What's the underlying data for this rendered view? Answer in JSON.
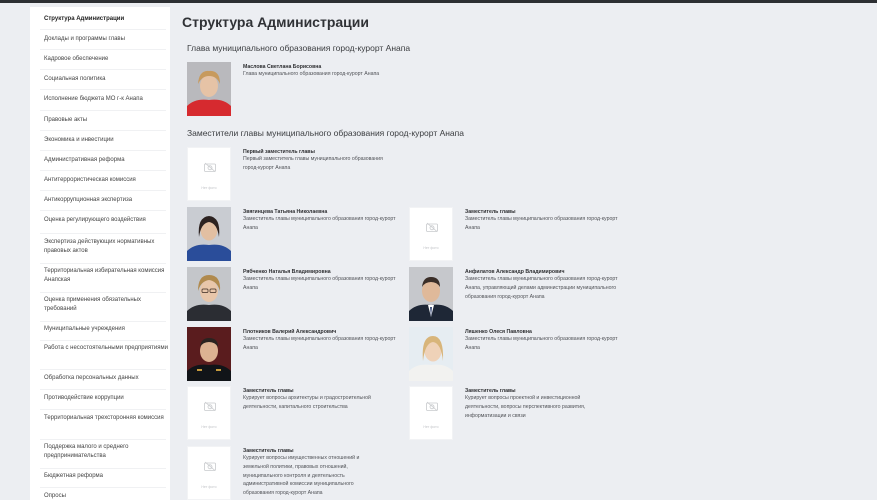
{
  "page_title": "Структура Администрации",
  "sidebar": {
    "items": [
      {
        "label": "Структура Администрации",
        "active": true
      },
      {
        "label": "Доклады и программы главы"
      },
      {
        "label": "Кадровое обеспечение"
      },
      {
        "label": "Социальная политика"
      },
      {
        "label": "Исполнение бюджета МО г-к Анапа"
      },
      {
        "label": "Правовые акты"
      },
      {
        "label": "Экономика и инвестиции"
      },
      {
        "label": "Административная реформа"
      },
      {
        "label": "Антитеррористическая комиссия"
      },
      {
        "label": "Антикоррупционная экспертиза"
      },
      {
        "label": "Оценка регулирующего воздействия"
      },
      {
        "label": "Экспертиза действующих нормативных правовых актов"
      },
      {
        "label": "Территориальная избирательная комиссия Анапская"
      },
      {
        "label": "Оценка применения обязательных требований"
      },
      {
        "label": "Муниципальные учреждения"
      },
      {
        "label": "Работа с несостоятельными предприятиями"
      },
      {
        "label": "Обработка персональных данных"
      },
      {
        "label": "Противодействие коррупции"
      },
      {
        "label": "Территориальная трехсторонняя комиссия"
      },
      {
        "label": "Поддержка малого и среднего предпринимательства"
      },
      {
        "label": "Бюджетная реформа"
      },
      {
        "label": "Опросы"
      }
    ]
  },
  "sections": {
    "head_title": "Глава муниципального образования город-курорт Анапа",
    "deputies_title": "Заместители главы муниципального образования город-курорт Анапа"
  },
  "no_photo_label": "Нет фото",
  "people": [
    {
      "name": "Маслова Светлана Борисовна",
      "position": "Глава муниципального образования город-курорт Анапа",
      "photo": "portrait-woman-red"
    },
    {
      "name": "Первый заместитель главы",
      "position": "Первый заместитель главы муниципального образования город-курорт Анапа",
      "photo": "no-photo"
    },
    {
      "name": "Звягинцева Татьяна Николаевна",
      "position": "Заместитель главы муниципального образования город-курорт Анапа",
      "photo": "portrait-woman-blue"
    },
    {
      "name": "Заместитель главы",
      "position": "Заместитель главы муниципального образования город-курорт Анапа",
      "photo": "no-photo"
    },
    {
      "name": "Рябченко Наталья Владимировна",
      "position": "Заместитель главы муниципального образования город-курорт Анапа",
      "photo": "portrait-woman-glasses"
    },
    {
      "name": "Анфилатов Александр Владимирович",
      "position": "Заместитель главы муниципального образования город-курорт Анапа, управляющий делами администрации муниципального образования город-курорт Анапа",
      "photo": "portrait-man-suit"
    },
    {
      "name": "Плотников Валерий Александрович",
      "position": "Заместитель главы муниципального образования город-курорт Анапа",
      "photo": "portrait-man-uniform"
    },
    {
      "name": "Ляшенко Олеся Павловна",
      "position": "Заместитель главы муниципального образования город-курорт Анапа",
      "photo": "portrait-woman-light"
    },
    {
      "name": "Заместитель главы",
      "position": "Курирует вопросы архитектуры и градостроительной деятельности, капитального строительства",
      "photo": "no-photo"
    },
    {
      "name": "Заместитель главы",
      "position": "Курирует вопросы проектной и инвестиционной деятельности, вопросы перспективного развития, информатизации и связи",
      "photo": "no-photo"
    },
    {
      "name": "Заместитель главы",
      "position": "Курирует вопросы имущественных отношений и земельной политики, правовых отношений, муниципального контроля и деятельность административной комиссии муниципального образования город-курорт Анапа",
      "photo": "no-photo"
    }
  ],
  "colors": {
    "page_bg": "#eceef2",
    "sidebar_bg": "#ffffff",
    "text_dark": "#2e2f32"
  }
}
